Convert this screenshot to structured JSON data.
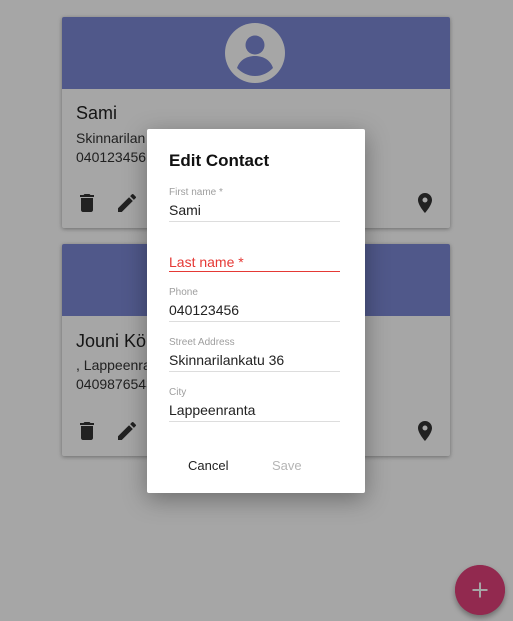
{
  "colors": {
    "card_header": "#7c88d4",
    "fab": "#e0407a",
    "error": "#e53935",
    "overlay": "rgba(0,0,0,0.35)"
  },
  "contacts": [
    {
      "name": "Sami",
      "line1": "Skinnarilan",
      "line2": "040123456",
      "icons": [
        "account-circle-icon",
        "delete-icon",
        "edit-icon",
        "place-icon"
      ]
    },
    {
      "name": "Jouni Kö",
      "line1": ", Lappeenra",
      "line2": "0409876543",
      "icons": [
        "delete-icon",
        "edit-icon",
        "place-icon"
      ]
    }
  ],
  "fab": {
    "icon": "plus-icon",
    "label": "+"
  },
  "dialog": {
    "title": "Edit Contact",
    "fields": {
      "first_name": {
        "label": "First name *",
        "value": "Sami"
      },
      "last_name": {
        "placeholder": "Last name *",
        "value": ""
      },
      "phone": {
        "label": "Phone",
        "value": "040123456"
      },
      "street": {
        "label": "Street Address",
        "value": "Skinnarilankatu 36"
      },
      "city": {
        "label": "City",
        "value": "Lappeenranta"
      }
    },
    "actions": {
      "cancel": "Cancel",
      "save": "Save"
    }
  }
}
